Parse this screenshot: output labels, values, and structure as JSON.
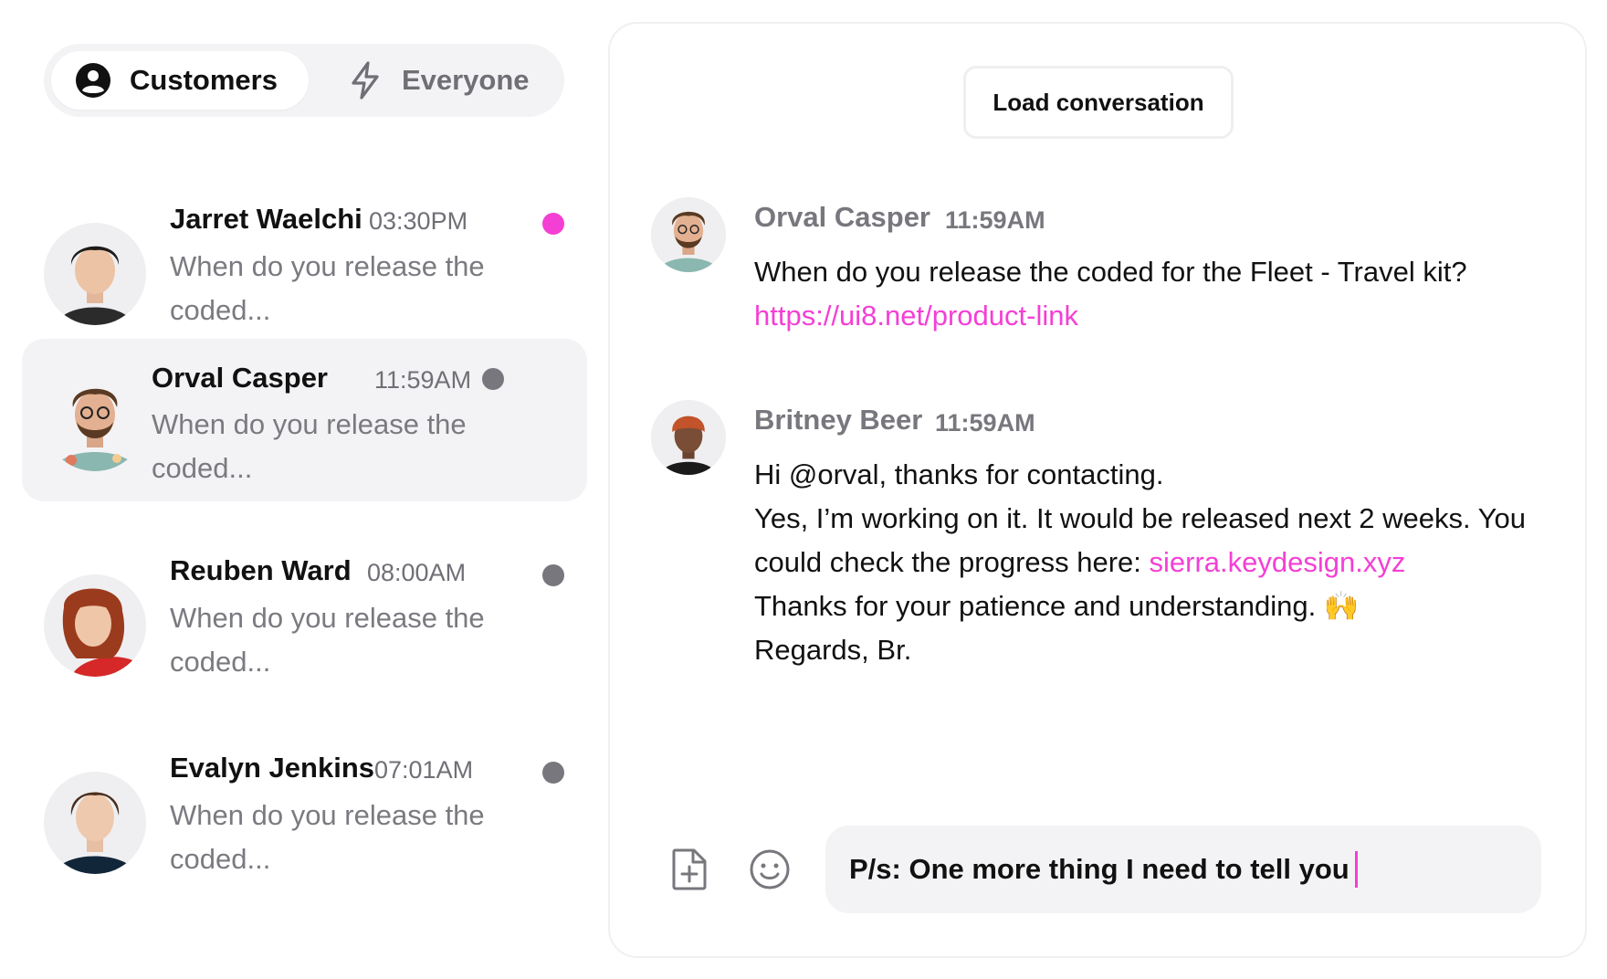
{
  "tabs": {
    "customers": {
      "label": "Customers",
      "icon": "user-circle-icon"
    },
    "everyone": {
      "label": "Everyone",
      "icon": "lightning-icon"
    }
  },
  "conversations": [
    {
      "name": "Jarret Waelchi",
      "time": "03:30PM",
      "preview": "When do you release the coded...",
      "unread": true,
      "selected": false
    },
    {
      "name": "Orval Casper",
      "time": "11:59AM",
      "preview": "When do you release the coded...",
      "unread": false,
      "selected": true
    },
    {
      "name": "Reuben Ward",
      "time": "08:00AM",
      "preview": "When do you release the coded...",
      "unread": false,
      "selected": false
    },
    {
      "name": "Evalyn Jenkins",
      "time": "07:01AM",
      "preview": "When do you release the coded...",
      "unread": false,
      "selected": false
    }
  ],
  "chat": {
    "load_label": "Load conversation",
    "messages": [
      {
        "author": "Orval Casper",
        "time": "11:59AM",
        "line1": "When do you release the coded for the Fleet - Travel kit?",
        "link": "https://ui8.net/product-link"
      },
      {
        "author": "Britney Beer",
        "time": "11:59AM",
        "line1": "Hi @orval, thanks for contacting.",
        "line2": "Yes, I’m working on it. It would be released next 2 weeks. You could check the progress here:",
        "link": "sierra.keydesign.xyz",
        "line3": "Thanks for your patience and understanding.",
        "emoji": "🙌",
        "line4": "Regards, Br."
      }
    ],
    "composer": {
      "value": "P/s: One more thing I need to tell you",
      "attach_icon": "file-plus-icon",
      "emoji_icon": "smiley-icon"
    }
  },
  "colors": {
    "accent": "#f43fd5",
    "unread_dot": "#f43fd5",
    "read_dot": "#77777d",
    "selected_bg": "#f3f3f5"
  }
}
